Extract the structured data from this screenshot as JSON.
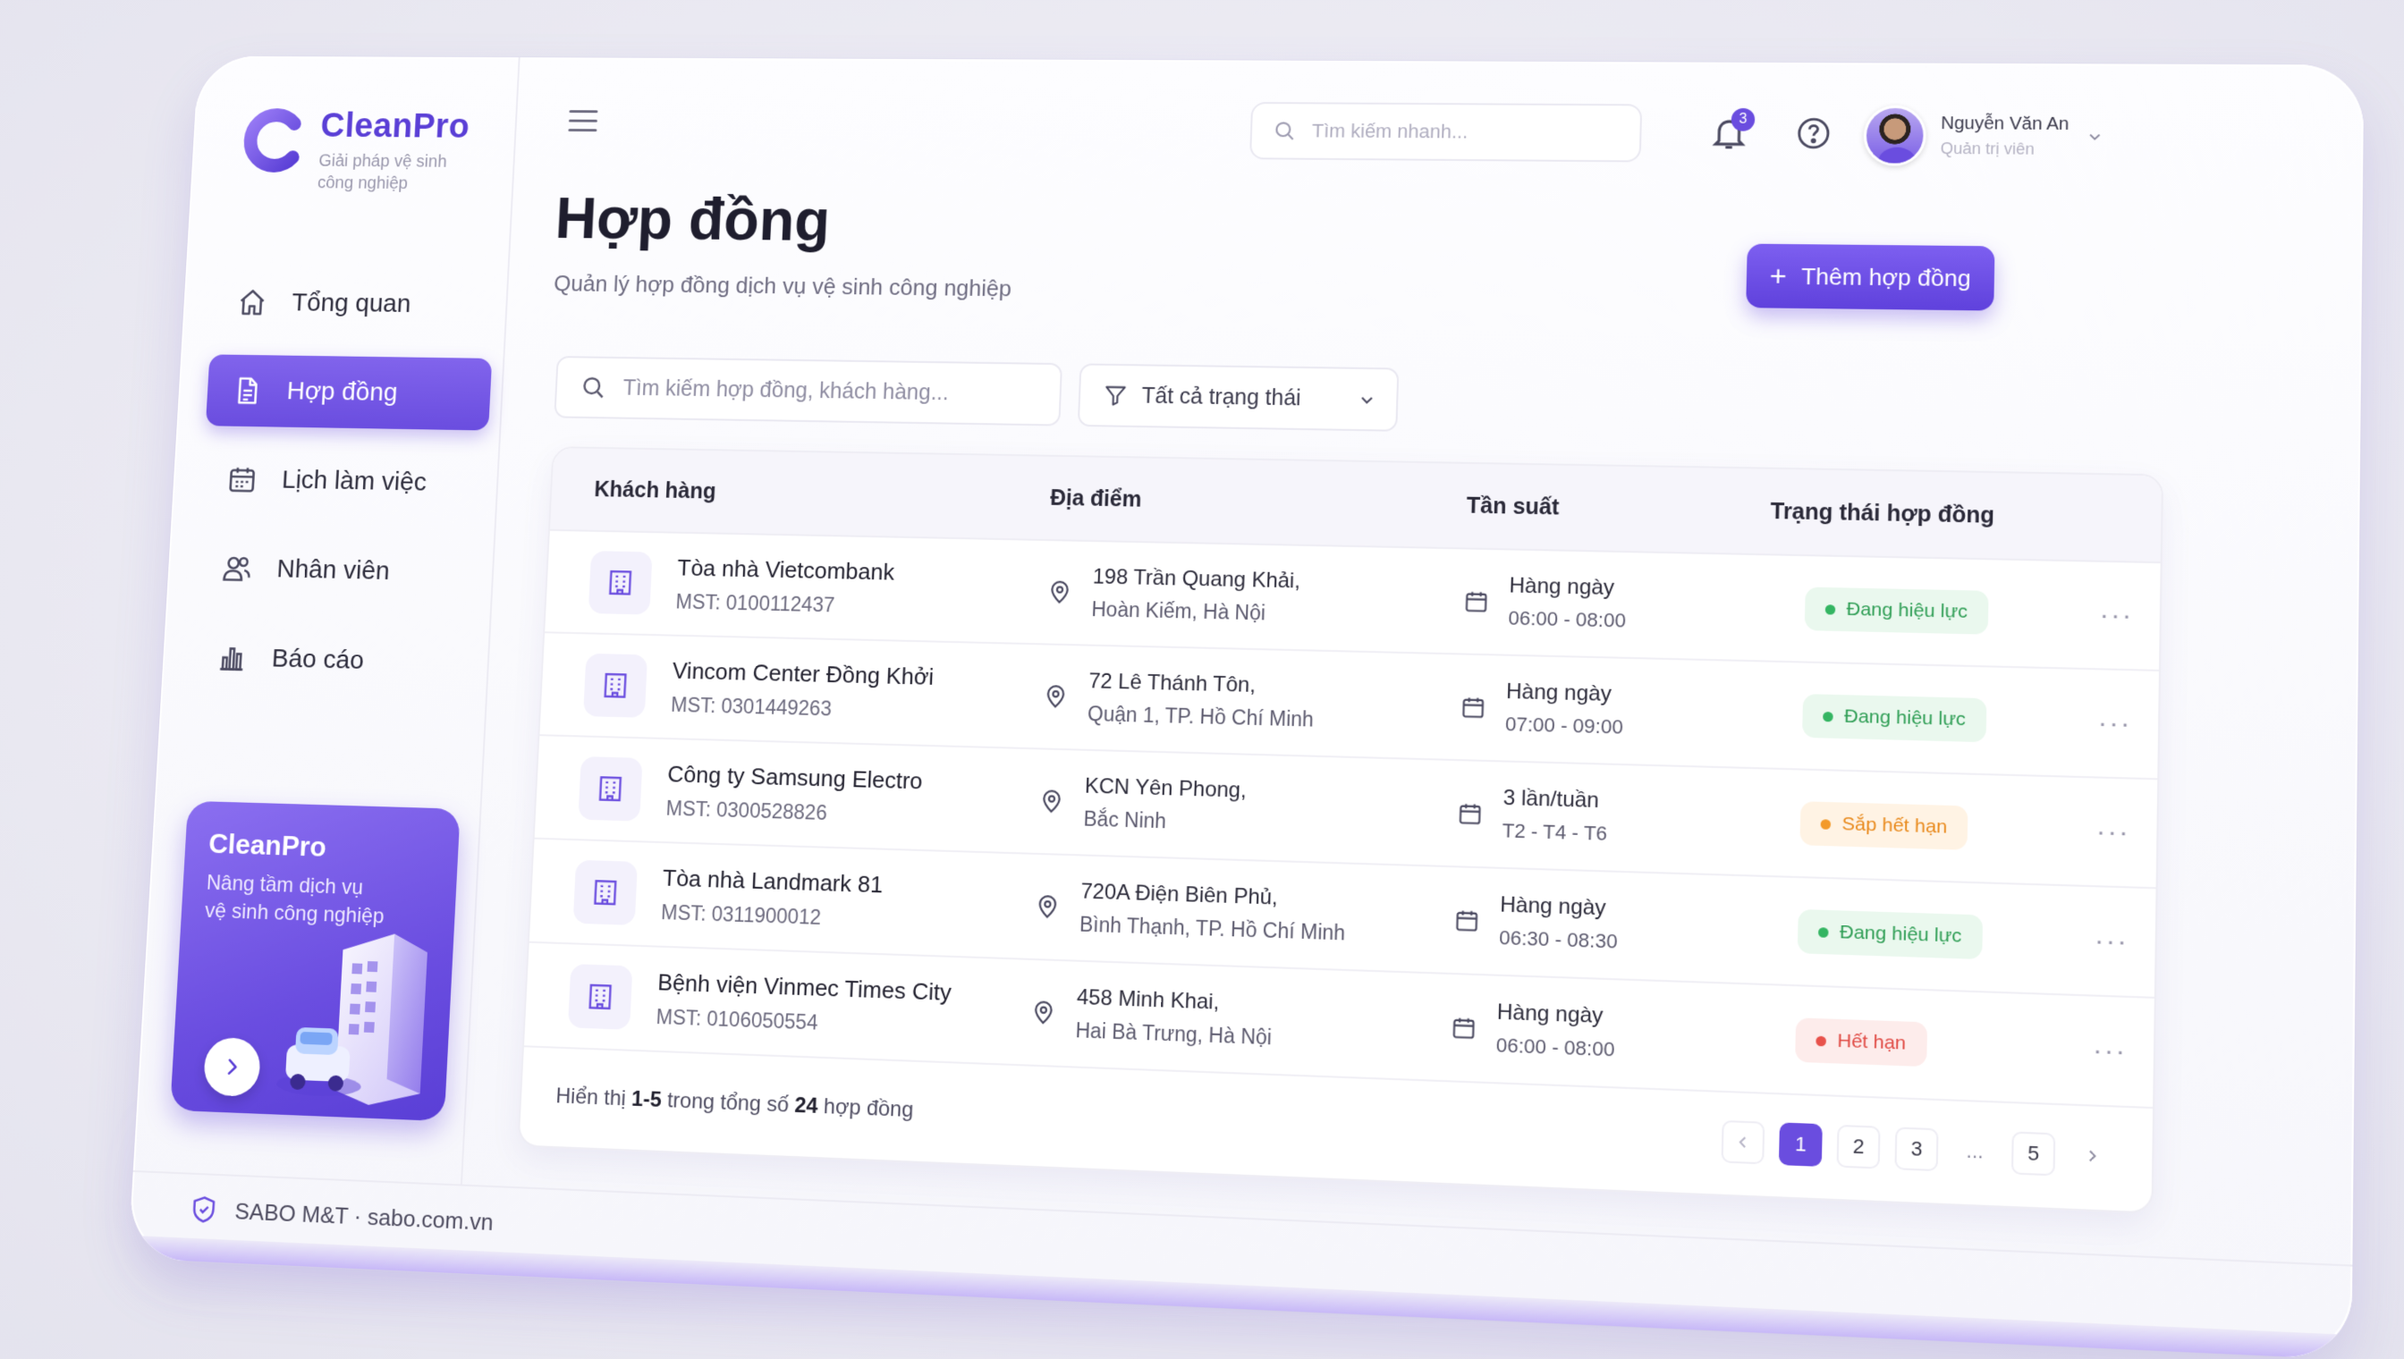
{
  "brand": {
    "name": "CleanPro",
    "tagline": "Giải pháp vệ sinh công nghiệp",
    "accent": "#6a4ddf"
  },
  "sidebar": {
    "items": [
      {
        "label": "Tổng quan",
        "icon": "home-icon",
        "active": false
      },
      {
        "label": "Hợp đồng",
        "icon": "document-icon",
        "active": true
      },
      {
        "label": "Lịch làm việc",
        "icon": "calendar-icon",
        "active": false
      },
      {
        "label": "Nhân viên",
        "icon": "users-icon",
        "active": false
      },
      {
        "label": "Báo cáo",
        "icon": "bar-chart-icon",
        "active": false
      }
    ],
    "promo": {
      "title": "CleanPro",
      "subtitle_line1": "Nâng tầm dịch vụ",
      "subtitle_line2": "vệ sinh công nghiệp"
    }
  },
  "header": {
    "quick_search_placeholder": "Tìm kiếm nhanh...",
    "notifications_count": "3",
    "user_name": "Nguyễn Văn An",
    "user_role": "Quản trị viên"
  },
  "page": {
    "title": "Hợp đồng",
    "subtitle": "Quản lý hợp đồng dịch vụ vệ sinh công nghiệp",
    "add_button": "Thêm hợp đồng",
    "search_placeholder": "Tìm kiếm hợp đồng, khách hàng...",
    "filter_value": "Tất cả trạng thái"
  },
  "table": {
    "columns": [
      "Khách hàng",
      "Địa điểm",
      "Tần suất",
      "Trạng thái hợp đồng"
    ],
    "rows": [
      {
        "name": "Tòa nhà Vietcombank",
        "mst": "MST: 0100112437",
        "addr1": "198 Trần Quang Khải,",
        "addr2": "Hoàn Kiếm, Hà Nội",
        "freq": "Hàng ngày",
        "time": "06:00 - 08:00",
        "status": "Đang hiệu lực",
        "status_color": "green"
      },
      {
        "name": "Vincom Center Đồng Khởi",
        "mst": "MST: 0301449263",
        "addr1": "72 Lê Thánh Tôn,",
        "addr2": "Quận 1, TP. Hồ Chí Minh",
        "freq": "Hàng ngày",
        "time": "07:00 - 09:00",
        "status": "Đang hiệu lực",
        "status_color": "green"
      },
      {
        "name": "Công ty Samsung Electro",
        "mst": "MST: 0300528826",
        "addr1": "KCN Yên Phong,",
        "addr2": "Bắc Ninh",
        "freq": "3 lần/tuần",
        "time": "T2 - T4 - T6",
        "status": "Sắp hết hạn",
        "status_color": "orange"
      },
      {
        "name": "Tòa nhà Landmark 81",
        "mst": "MST: 0311900012",
        "addr1": "720A Điện Biên Phủ,",
        "addr2": "Bình Thạnh, TP. Hồ Chí Minh",
        "freq": "Hàng ngày",
        "time": "06:30 - 08:30",
        "status": "Đang hiệu lực",
        "status_color": "green"
      },
      {
        "name": "Bệnh viện Vinmec Times City",
        "mst": "MST: 0106050554",
        "addr1": "458 Minh Khai,",
        "addr2": "Hai Bà Trưng, Hà Nội",
        "freq": "Hàng ngày",
        "time": "06:00 - 08:00",
        "status": "Hết hạn",
        "status_color": "red"
      }
    ],
    "summary_prefix": "Hiển thị",
    "summary_range": "1-5",
    "summary_middle": "trong tổng số",
    "summary_total": "24",
    "summary_suffix": "hợp đồng",
    "more": "···",
    "pages": [
      "1",
      "2",
      "3",
      "...",
      "5"
    ],
    "current_page": "1"
  },
  "footer": {
    "text": "SABO M&T · sabo.com.vn"
  }
}
